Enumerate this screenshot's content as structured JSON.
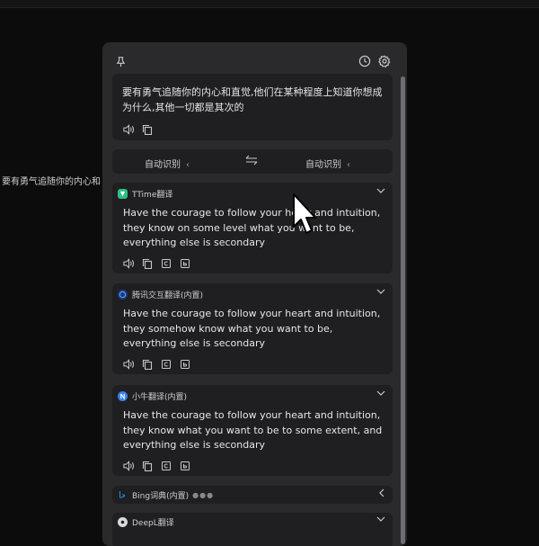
{
  "background_text": "要有勇气追随你的内心和",
  "source": {
    "text": "要有勇气追随你的内心和直觉,他们在某种程度上知道你想成为什么,其他一切都是其次的"
  },
  "languages": {
    "source": "自动识别",
    "target": "自动识别"
  },
  "services": [
    {
      "name": "TTime翻译",
      "text": "Have the courage to follow your heart and intuition, they know on some level what you want to be, everything else is secondary",
      "logo_color": "#2fbf86"
    },
    {
      "name": "腾讯交互翻译(内置)",
      "text": "Have the courage to follow your heart and intuition, they somehow know what you want to be, everything else is secondary",
      "logo_color": "#2d6fe0"
    },
    {
      "name": "小牛翻译(内置)",
      "text": "Have the courage to follow your heart and intuition, they know what you want to be to some extent, and everything else is secondary",
      "logo_color": "#3b7ff0"
    },
    {
      "name": "Bing词典(内置)",
      "logo_color": "#1f8fe0"
    },
    {
      "name": "DeepL翻译",
      "logo_color": "#d9d9d9"
    }
  ],
  "colors": {
    "panel": "#2a2a2c",
    "card": "#1f1f21",
    "icon": "#c8c8c8"
  }
}
